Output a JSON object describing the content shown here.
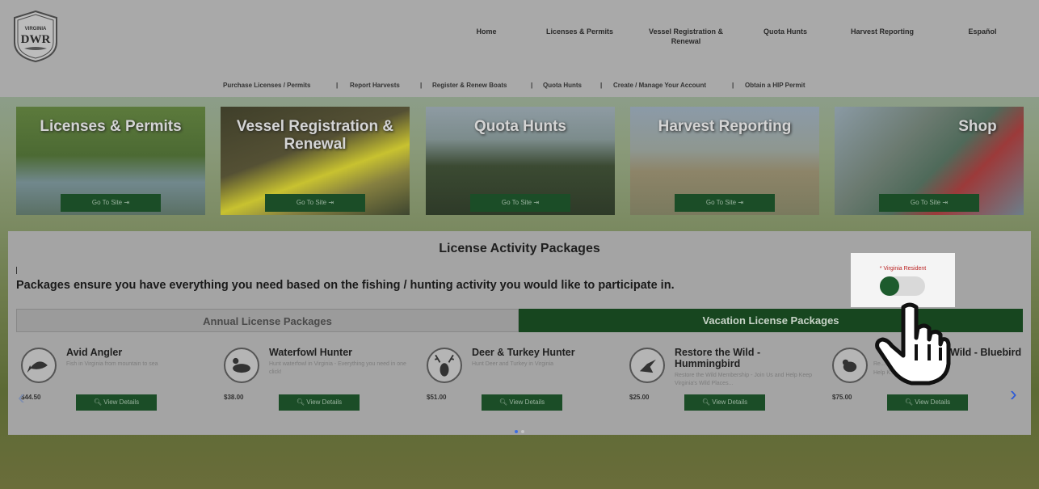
{
  "header": {
    "logo": {
      "top": "VIRGINIA",
      "bottom": "DWR"
    },
    "nav": [
      "Home",
      "Licenses & Permits",
      "Vessel Registration & Renewal",
      "Quota Hunts",
      "Harvest Reporting",
      "Español"
    ],
    "subnav": [
      "Purchase Licenses / Permits",
      "Report Harvests",
      "Register & Renew Boats",
      "Quota Hunts",
      "Create / Manage Your Account",
      "Obtain a HIP Permit"
    ]
  },
  "tiles": [
    {
      "title": "Licenses & Permits",
      "button": "Go To Site"
    },
    {
      "title": "Vessel Registration & Renewal",
      "button": "Go To Site"
    },
    {
      "title": "Quota Hunts",
      "button": "Go To Site"
    },
    {
      "title": "Harvest Reporting",
      "button": "Go To Site"
    },
    {
      "title": "Shop",
      "button": "Go To Site"
    }
  ],
  "packages": {
    "title": "License Activity Packages",
    "subtitle": "Packages ensure you have everything you need based on the fishing / hunting activity you would like to participate in.",
    "toggle_label": "Virginia Resident",
    "toggle_required_mark": "*",
    "tabs": [
      "Annual License Packages",
      "Vacation License Packages"
    ],
    "active_tab": "Vacation License Packages",
    "cards": [
      {
        "name": "Avid Angler",
        "desc": "Fish in Virginia from mountain to sea",
        "price": "$44.50",
        "button": "View Details",
        "icon": "fish-icon"
      },
      {
        "name": "Waterfowl Hunter",
        "desc": "Hunt waterfowl in Virginia - Everything you need in one click!",
        "price": "$38.00",
        "button": "View Details",
        "icon": "duck-icon"
      },
      {
        "name": "Deer & Turkey Hunter",
        "desc": "Hunt Deer and Turkey in Virginia",
        "price": "$51.00",
        "button": "View Details",
        "icon": "deer-icon"
      },
      {
        "name": "Restore the Wild - Hummingbird",
        "desc": "Restore the Wild Membership - Join Us and Help Keep Virginia's Wild Places...",
        "price": "$25.00",
        "button": "View Details",
        "icon": "hummingbird-icon"
      },
      {
        "name": "Wild - Bluebird",
        "desc_line1": "Re...   ...ership - Join Us and",
        "desc_line2": "Help K...   ...Wild Places...",
        "price": "$75.00",
        "button": "View Details",
        "icon": "bluebird-icon"
      }
    ]
  },
  "colors": {
    "brand_green": "#1b4d27",
    "active_tab": "#17461f",
    "required": "#b22222"
  }
}
